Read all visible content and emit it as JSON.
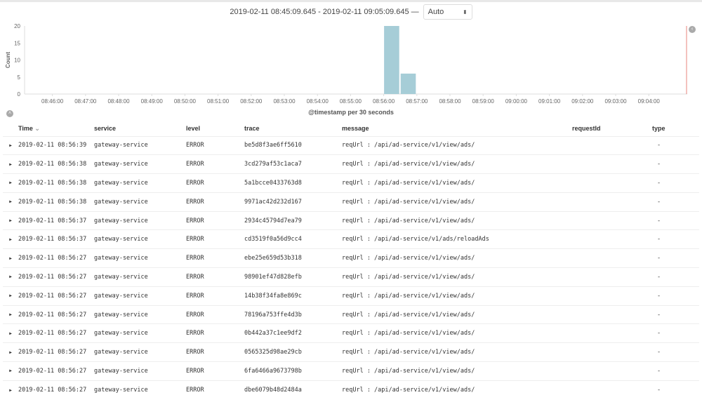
{
  "time_range": {
    "label": "2019-02-11 08:45:09.645 - 2019-02-11 09:05:09.645 —",
    "interval": "Auto"
  },
  "chart_data": {
    "type": "bar",
    "title": "",
    "xlabel": "@timestamp per 30 seconds",
    "ylabel": "Count",
    "ylim": [
      0,
      20
    ],
    "yticks": [
      "0",
      "5",
      "10",
      "15",
      "20"
    ],
    "xticks": [
      "08:46:00",
      "08:47:00",
      "08:48:00",
      "08:49:00",
      "08:50:00",
      "08:51:00",
      "08:52:00",
      "08:53:00",
      "08:54:00",
      "08:55:00",
      "08:56:00",
      "08:57:00",
      "08:58:00",
      "08:59:00",
      "09:00:00",
      "09:01:00",
      "09:02:00",
      "09:03:00",
      "09:04:00"
    ],
    "x_range_minutes": [
      0,
      20
    ],
    "x_start": "08:45:09.645",
    "bars": [
      {
        "x": "08:56:00",
        "value": 20
      },
      {
        "x": "08:56:30",
        "value": 6
      }
    ],
    "bar_color": "#a6cdd7",
    "now_marker_color": "#e8847e"
  },
  "table": {
    "headers": [
      "Time",
      "service",
      "level",
      "trace",
      "message",
      "requestId",
      "type"
    ],
    "rows": [
      [
        "2019-02-11 08:56:39",
        "gateway-service",
        "ERROR",
        "be5d8f3ae6ff5610",
        "reqUrl : /api/ad-service/v1/view/ads/",
        "",
        "-"
      ],
      [
        "2019-02-11 08:56:38",
        "gateway-service",
        "ERROR",
        "3cd279af53c1aca7",
        "reqUrl : /api/ad-service/v1/view/ads/",
        "",
        "-"
      ],
      [
        "2019-02-11 08:56:38",
        "gateway-service",
        "ERROR",
        "5a1bcce0433763d8",
        "reqUrl : /api/ad-service/v1/view/ads/",
        "",
        "-"
      ],
      [
        "2019-02-11 08:56:38",
        "gateway-service",
        "ERROR",
        "9971ac42d232d167",
        "reqUrl : /api/ad-service/v1/view/ads/",
        "",
        "-"
      ],
      [
        "2019-02-11 08:56:37",
        "gateway-service",
        "ERROR",
        "2934c45794d7ea79",
        "reqUrl : /api/ad-service/v1/view/ads/",
        "",
        "-"
      ],
      [
        "2019-02-11 08:56:37",
        "gateway-service",
        "ERROR",
        "cd3519f0a56d9cc4",
        "reqUrl : /api/ad-service/v1/ads/reloadAds",
        "",
        "-"
      ],
      [
        "2019-02-11 08:56:27",
        "gateway-service",
        "ERROR",
        "ebe25e659d53b318",
        "reqUrl : /api/ad-service/v1/view/ads/",
        "",
        "-"
      ],
      [
        "2019-02-11 08:56:27",
        "gateway-service",
        "ERROR",
        "98901ef47d828efb",
        "reqUrl : /api/ad-service/v1/view/ads/",
        "",
        "-"
      ],
      [
        "2019-02-11 08:56:27",
        "gateway-service",
        "ERROR",
        "14b38f34fa8e869c",
        "reqUrl : /api/ad-service/v1/view/ads/",
        "",
        "-"
      ],
      [
        "2019-02-11 08:56:27",
        "gateway-service",
        "ERROR",
        "78196a753ffe4d3b",
        "reqUrl : /api/ad-service/v1/view/ads/",
        "",
        "-"
      ],
      [
        "2019-02-11 08:56:27",
        "gateway-service",
        "ERROR",
        "0b442a37c1ee9df2",
        "reqUrl : /api/ad-service/v1/view/ads/",
        "",
        "-"
      ],
      [
        "2019-02-11 08:56:27",
        "gateway-service",
        "ERROR",
        "0565325d98ae29cb",
        "reqUrl : /api/ad-service/v1/view/ads/",
        "",
        "-"
      ],
      [
        "2019-02-11 08:56:27",
        "gateway-service",
        "ERROR",
        "6fa6466a9673798b",
        "reqUrl : /api/ad-service/v1/view/ads/",
        "",
        "-"
      ],
      [
        "2019-02-11 08:56:27",
        "gateway-service",
        "ERROR",
        "dbe6079b48d2484a",
        "reqUrl : /api/ad-service/v1/view/ads/",
        "",
        "-"
      ]
    ]
  }
}
